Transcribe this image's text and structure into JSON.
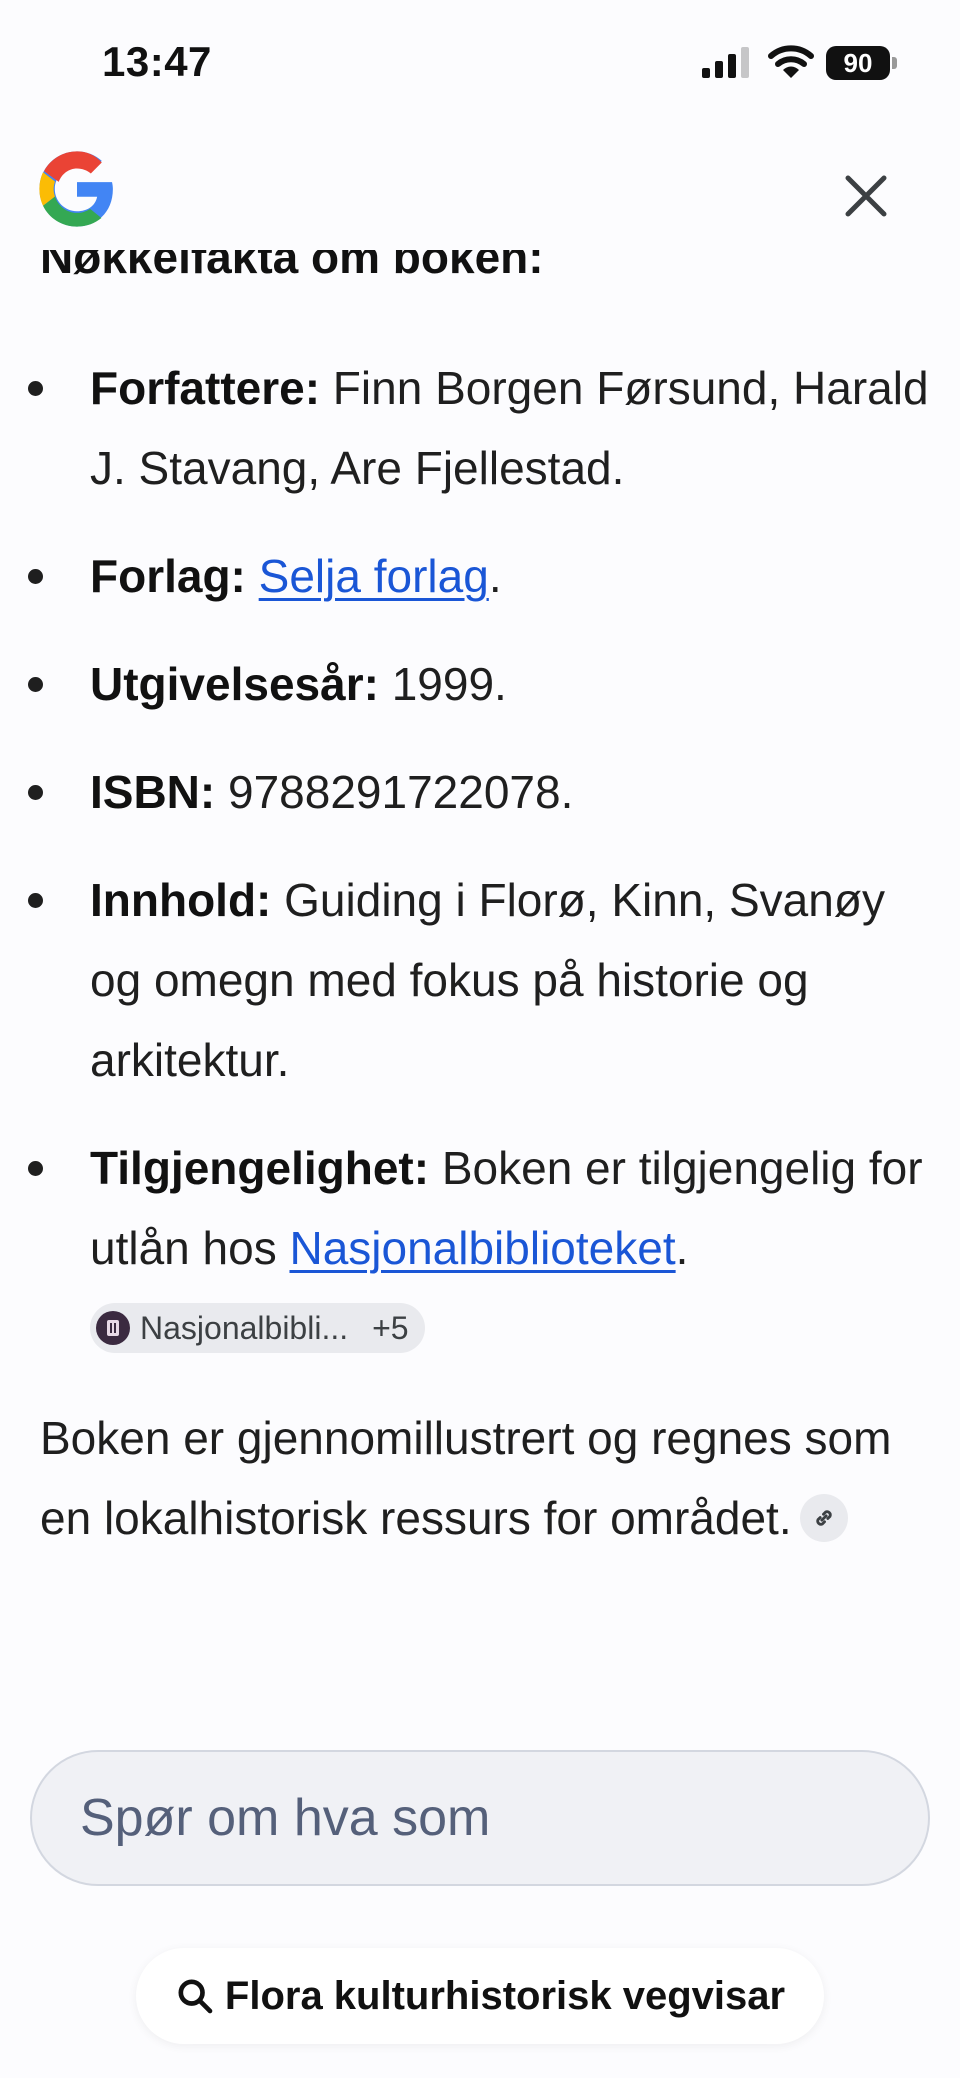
{
  "status_bar": {
    "time": "13:47",
    "battery": "90"
  },
  "content": {
    "heading": "Nøkkelfakta om boken:",
    "facts": [
      {
        "label": "Forfattere:",
        "text": " Finn Borgen Førsund, Harald J. Stavang, Are Fjellestad."
      },
      {
        "label": "Forlag:",
        "link": "Selja forlag",
        "after": "."
      },
      {
        "label": "Utgivelsesår:",
        "text": " 1999."
      },
      {
        "label": "ISBN:",
        "text": " 9788291722078."
      },
      {
        "label": "Innhold:",
        "text": " Guiding i Florø, Kinn, Svanøy og omegn med fokus på historie og arkitektur."
      },
      {
        "label": "Tilgjengelighet:",
        "text": " Boken er tilgjengelig for utlån hos ",
        "link": "Nasjonalbiblioteket",
        "after": ".",
        "source_chip": {
          "name": "Nasjonalbibli...",
          "count": "+5"
        }
      }
    ],
    "summary": "Boken er gjennomillustrert og regnes som en lokalhistorisk ressurs for området."
  },
  "input": {
    "placeholder": "Spør om hva som"
  },
  "search_suggestion": {
    "label": "Flora kulturhistorisk vegvisar"
  },
  "icons": {
    "logo": "google-logo",
    "close": "close-icon",
    "link": "link-icon",
    "search": "search-icon"
  }
}
